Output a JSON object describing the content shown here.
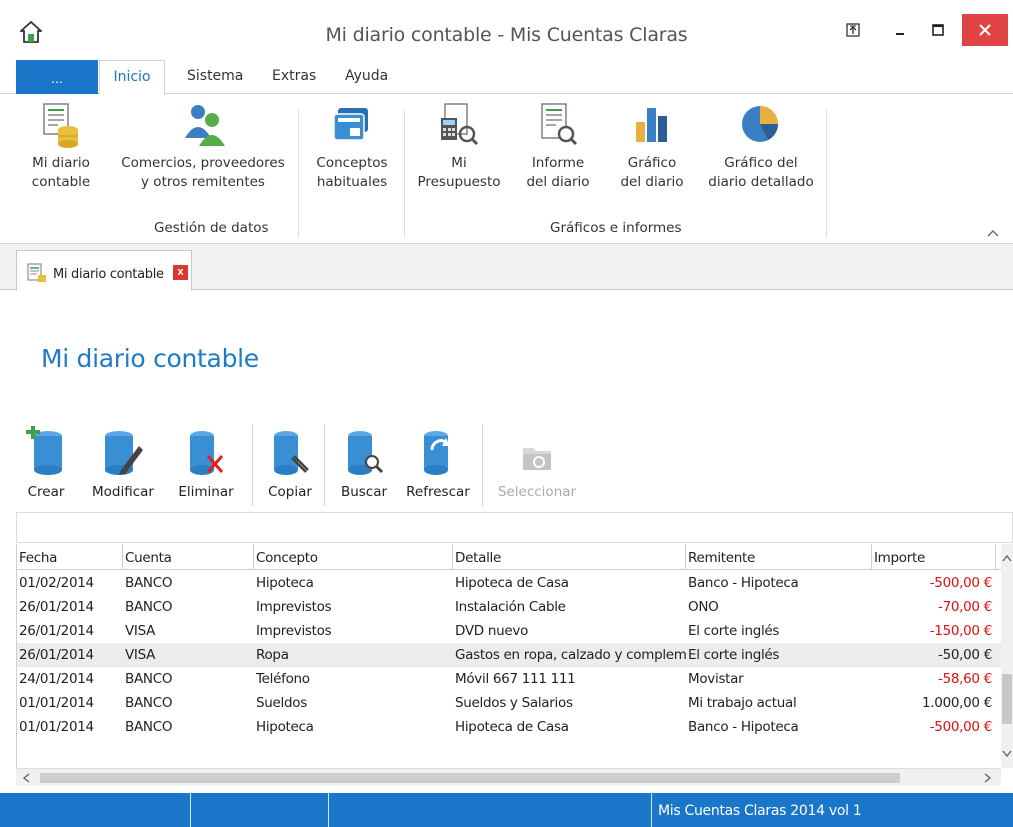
{
  "window": {
    "title": "Mi diario contable - Mis Cuentas Claras"
  },
  "ribbon_tabs": {
    "file": "...",
    "active": "Inicio",
    "items": [
      "Sistema",
      "Extras",
      "Ayuda"
    ]
  },
  "ribbon": {
    "buttons": [
      {
        "line1": "Mi diario",
        "line2": "contable"
      },
      {
        "line1": "Comercios, proveedores",
        "line2": "y otros remitentes"
      },
      {
        "line1": "Conceptos",
        "line2": "habituales"
      },
      {
        "line1": "Mi",
        "line2": "Presupuesto"
      },
      {
        "line1": "Informe",
        "line2": "del diario"
      },
      {
        "line1": "Gráfico",
        "line2": "del diario"
      },
      {
        "line1": "Gráfico del",
        "line2": "diario detallado"
      }
    ],
    "groups": [
      "Gestión de datos",
      "Gráficos e informes"
    ],
    "collapse": "^"
  },
  "document_tab": {
    "label": "Mi diario contable",
    "close": "x"
  },
  "page": {
    "title": "Mi diario contable"
  },
  "toolbar": [
    "Crear",
    "Modificar",
    "Eliminar",
    "Copiar",
    "Buscar",
    "Refrescar",
    "Seleccionar"
  ],
  "grid": {
    "columns": [
      "Fecha",
      "Cuenta",
      "Concepto",
      "Detalle",
      "Remitente",
      "Importe"
    ],
    "rows": [
      {
        "fecha": "01/02/2014",
        "cuenta": "BANCO",
        "concepto": "Hipoteca",
        "detalle": "Hipoteca de Casa",
        "remitente": "Banco - Hipoteca",
        "importe": "-500,00 €",
        "negative": true
      },
      {
        "fecha": "26/01/2014",
        "cuenta": "BANCO",
        "concepto": "Imprevistos",
        "detalle": "Instalación Cable",
        "remitente": "ONO",
        "importe": "-70,00 €",
        "negative": true
      },
      {
        "fecha": "26/01/2014",
        "cuenta": "VISA",
        "concepto": "Imprevistos",
        "detalle": "DVD nuevo",
        "remitente": "El corte inglés",
        "importe": "-150,00 €",
        "negative": true
      },
      {
        "fecha": "26/01/2014",
        "cuenta": "VISA",
        "concepto": "Ropa",
        "detalle": "Gastos en ropa, calzado y complementos",
        "remitente": "El corte inglés",
        "importe": "-50,00 €",
        "negative": false,
        "selected": true
      },
      {
        "fecha": "24/01/2014",
        "cuenta": "BANCO",
        "concepto": "Teléfono",
        "detalle": "Móvil 667 111 111",
        "remitente": "Movistar",
        "importe": "-58,60 €",
        "negative": true
      },
      {
        "fecha": "01/01/2014",
        "cuenta": "BANCO",
        "concepto": "Sueldos",
        "detalle": "Sueldos y Salarios",
        "remitente": "Mi trabajo actual",
        "importe": "1.000,00 €",
        "negative": false
      },
      {
        "fecha": "01/01/2014",
        "cuenta": "BANCO",
        "concepto": "Hipoteca",
        "detalle": "Hipoteca de Casa",
        "remitente": "Banco - Hipoteca",
        "importe": "-500,00 €",
        "negative": true
      }
    ]
  },
  "statusbar": {
    "text": "Mis Cuentas Claras 2014 vol 1"
  },
  "colors": {
    "accent": "#1a76c9",
    "negative": "#e01010",
    "close": "#e04343"
  }
}
